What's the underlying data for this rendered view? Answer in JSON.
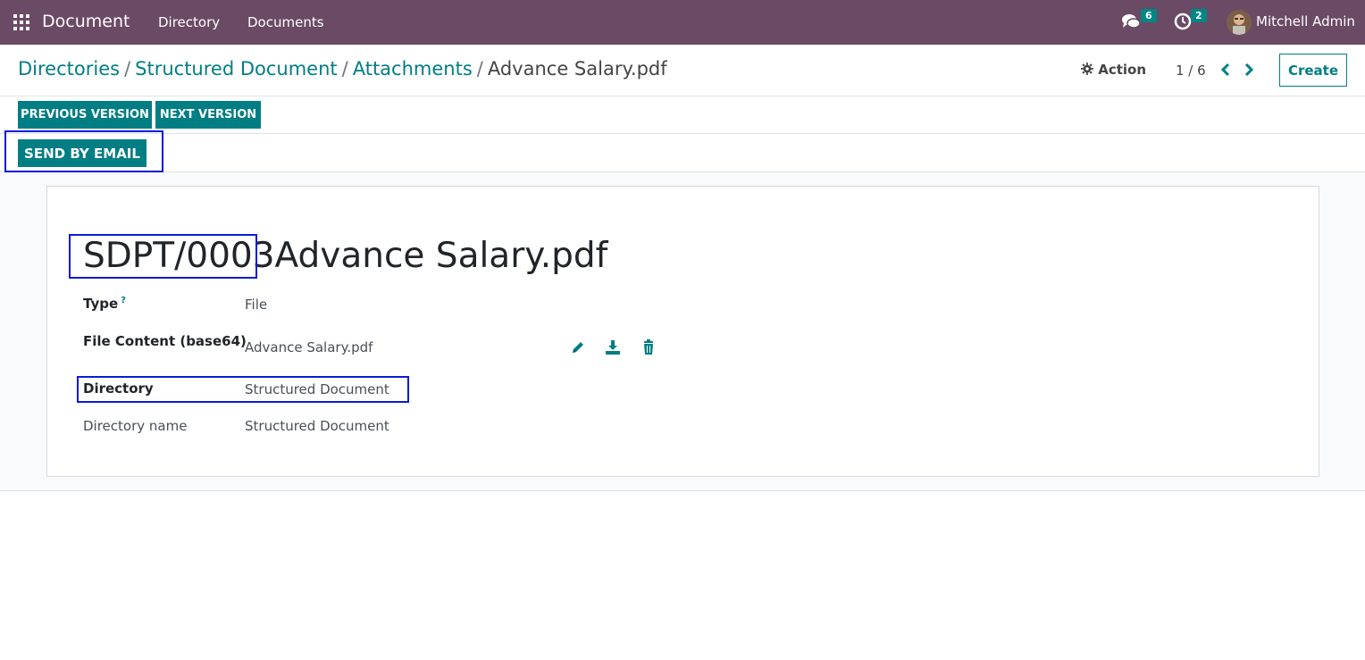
{
  "navbar": {
    "app_name": "Document",
    "menu": [
      "Directory",
      "Documents"
    ],
    "messages_count": "6",
    "activities_count": "2",
    "user_name": "Mitchell Admin"
  },
  "breadcrumb": {
    "items": [
      "Directories",
      "Structured Document",
      "Attachments"
    ],
    "current": "Advance Salary.pdf",
    "separator": "/"
  },
  "control": {
    "action_label": "Action",
    "pager": "1 / 6",
    "create_label": "Create"
  },
  "buttons": {
    "previous_version": "PREVIOUS VERSION",
    "next_version": "NEXT VERSION",
    "send_by_email": "SEND BY EMAIL"
  },
  "record": {
    "code": "SDPT/0003",
    "name": "Advance Salary.pdf"
  },
  "fields": {
    "type_label": "Type",
    "type_help": "?",
    "type_value": "File",
    "file_content_label": "File Content (base64)",
    "file_content_value": "Advance Salary.pdf",
    "directory_label": "Directory",
    "directory_value": "Structured Document",
    "directory_name_label": "Directory name",
    "directory_name_value": "Structured Document"
  },
  "colors": {
    "navbar": "#6b4a65",
    "accent": "#017e84",
    "badge": "#008784",
    "highlight": "#0a1bd8"
  },
  "icons": [
    "apps-grid-icon",
    "chat-icon",
    "clock-icon",
    "gear-icon",
    "chevron-left-icon",
    "chevron-right-icon",
    "pencil-icon",
    "download-icon",
    "trash-icon"
  ]
}
